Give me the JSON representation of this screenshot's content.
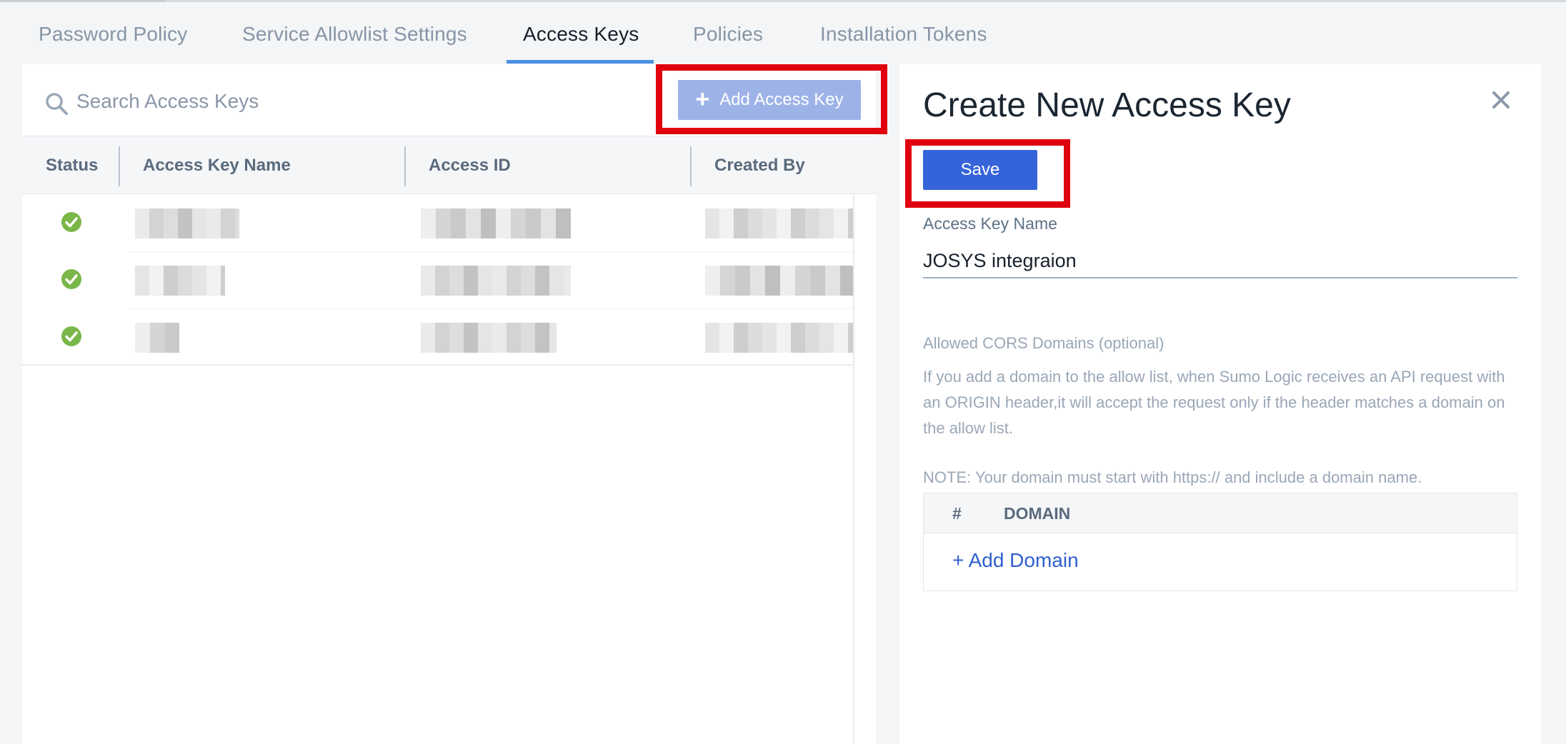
{
  "tabs": [
    {
      "label": "Password Policy",
      "active": false
    },
    {
      "label": "Service Allowlist Settings",
      "active": false
    },
    {
      "label": "Access Keys",
      "active": true
    },
    {
      "label": "Policies",
      "active": false
    },
    {
      "label": "Installation Tokens",
      "active": false
    }
  ],
  "access_keys": {
    "search_placeholder": "Search Access Keys",
    "add_button_label": "Add Access Key",
    "columns": [
      "Status",
      "Access Key Name",
      "Access ID",
      "Created By"
    ],
    "rows": [
      {
        "status": "active"
      },
      {
        "status": "active"
      },
      {
        "status": "active"
      }
    ]
  },
  "create_panel": {
    "title": "Create New Access Key",
    "save_label": "Save",
    "name_label": "Access Key Name",
    "name_value": "JOSYS integraion",
    "cors_label": "Allowed CORS Domains (optional)",
    "cors_description": "If you add a domain to the allow list, when Sumo Logic receives an API request with an ORIGIN header,it will accept the request only if the header matches a domain on the allow list.",
    "cors_note": "NOTE: Your domain must start with https:// and include a domain name.",
    "domain_columns": [
      "#",
      "DOMAIN"
    ],
    "add_domain_label": "+ Add Domain"
  },
  "colors": {
    "accent": "#3563d9",
    "tab_underline": "#4a90e2",
    "status_ok": "#7ab648",
    "highlight": "#e0000e"
  }
}
